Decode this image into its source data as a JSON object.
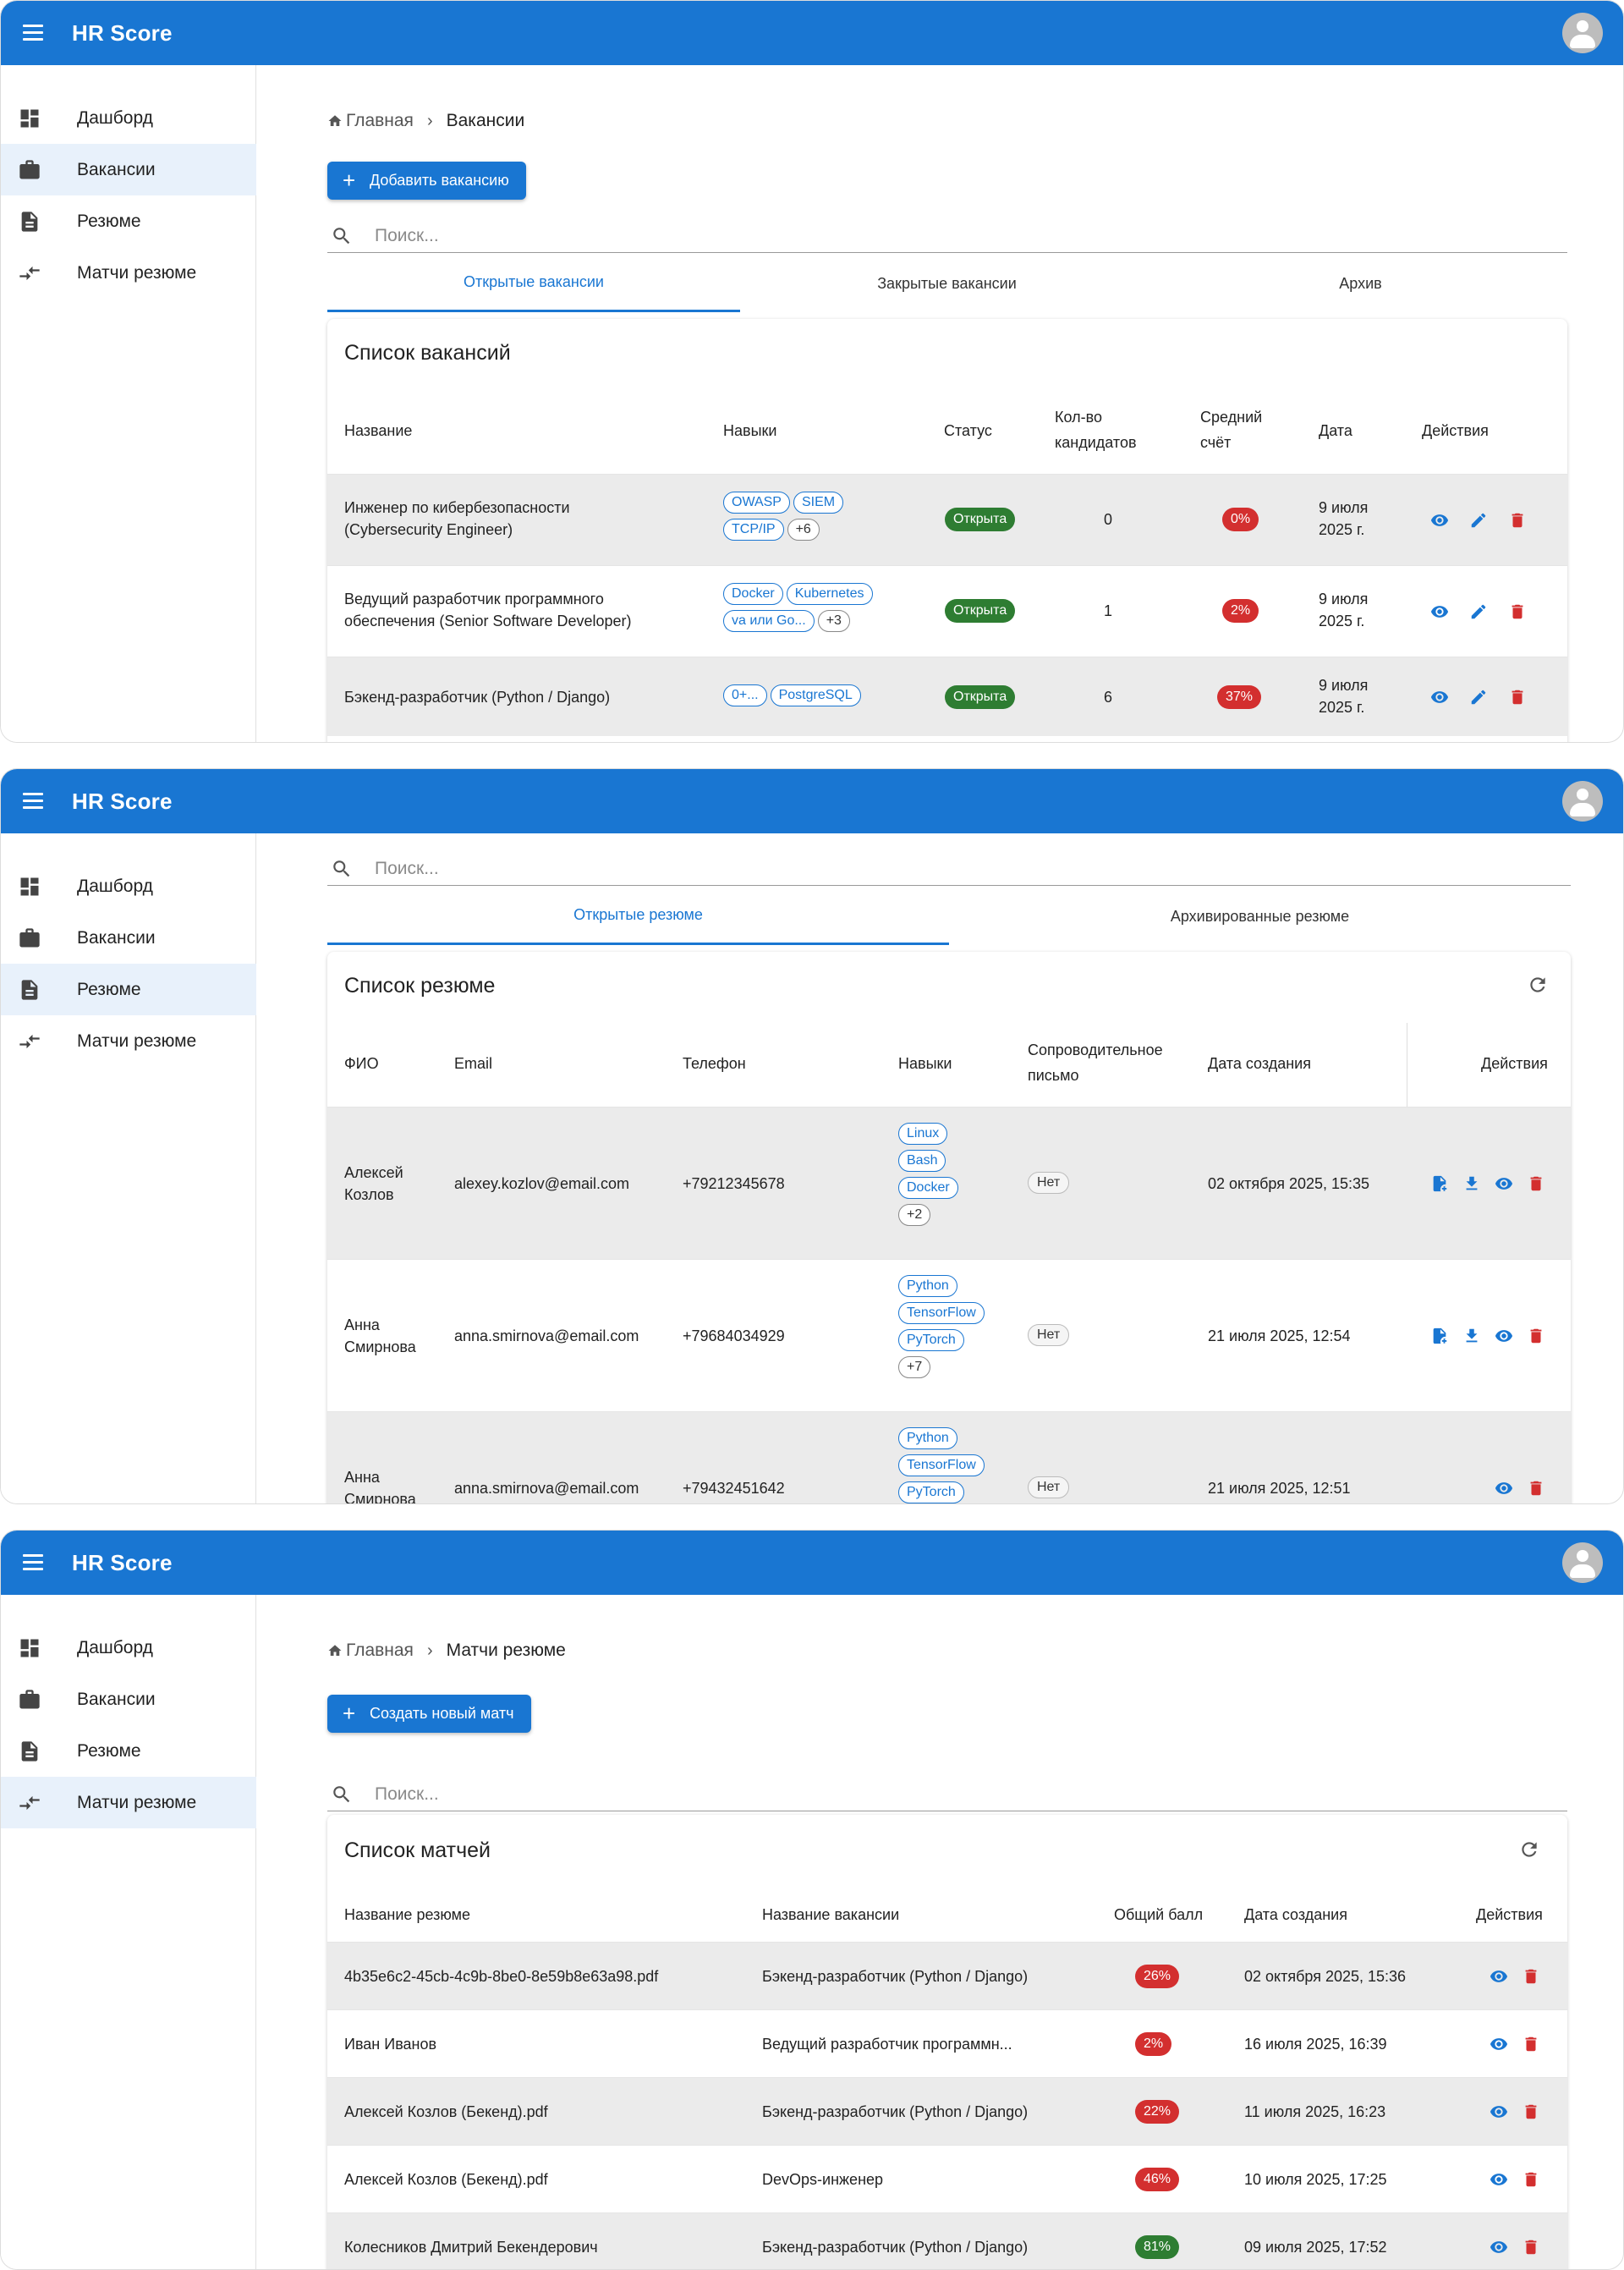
{
  "app": {
    "title": "HR Score"
  },
  "nav": {
    "dashboard": "Дашборд",
    "vacancies": "Вакансии",
    "resumes": "Резюме",
    "matches": "Матчи резюме"
  },
  "vacancies_page": {
    "breadcrumb": {
      "home": "Главная",
      "current": "Вакансии"
    },
    "add_button": "Добавить вакансию",
    "search_placeholder": "Поиск...",
    "tabs": [
      "Открытые вакансии",
      "Закрытые вакансии",
      "Архив"
    ],
    "card_title": "Список вакансий",
    "headers": {
      "name": "Название",
      "skills": "Навыки",
      "status": "Статус",
      "count_1": "Кол-во",
      "count_2": "кандидатов",
      "score_1": "Средний",
      "score_2": "счёт",
      "date": "Дата",
      "actions": "Действия"
    },
    "rows": [
      {
        "name_1": "Инженер по кибербезопасности",
        "name_2": "(Cybersecurity Engineer)",
        "skills": [
          "OWASP",
          "SIEM",
          "TCP/IP"
        ],
        "more": "+6",
        "status": "Открыта",
        "count": "0",
        "score": "0%",
        "date_1": "9 июля",
        "date_2": "2025 г."
      },
      {
        "name_1": "Ведущий разработчик программного",
        "name_2": "обеспечения (Senior Software Developer)",
        "skills": [
          "Docker",
          "Kubernetes",
          "va или Go..."
        ],
        "more": "+3",
        "status": "Открыта",
        "count": "1",
        "score": "2%",
        "date_1": "9 июля",
        "date_2": "2025 г."
      },
      {
        "name_1": "Бэкенд-разработчик (Python / Django)",
        "name_2": "",
        "skills": [
          "0+...",
          "PostgreSQL"
        ],
        "more": "",
        "status": "Открыта",
        "count": "6",
        "score": "37%",
        "date_1": "9 июля",
        "date_2": "2025 г."
      }
    ]
  },
  "resumes_page": {
    "search_placeholder": "Поиск...",
    "tabs": [
      "Открытые резюме",
      "Архивированные резюме"
    ],
    "card_title": "Список резюме",
    "headers": {
      "fio": "ФИО",
      "email": "Email",
      "phone": "Телефон",
      "skills": "Навыки",
      "cover_1": "Сопроводительное",
      "cover_2": "письмо",
      "created": "Дата создания",
      "actions": "Действия"
    },
    "rows": [
      {
        "name_1": "Алексей",
        "name_2": "Козлов",
        "email": "alexey.kozlov@email.com",
        "phone": "+79212345678",
        "skills": [
          "Linux",
          "Bash",
          "Docker"
        ],
        "more": "+2",
        "cover": "Нет",
        "created": "02 октября 2025, 15:35"
      },
      {
        "name_1": "Анна",
        "name_2": "Смирнова",
        "email": "anna.smirnova@email.com",
        "phone": "+79684034929",
        "skills": [
          "Python",
          "TensorFlow",
          "PyTorch"
        ],
        "more": "+7",
        "cover": "Нет",
        "created": "21 июля 2025, 12:54"
      },
      {
        "name_1": "Анна",
        "name_2": "Смирнова",
        "email": "anna.smirnova@email.com",
        "phone": "+79432451642",
        "skills": [
          "Python",
          "TensorFlow",
          "PyTorch"
        ],
        "more": "",
        "cover": "Нет",
        "created": "21 июля 2025, 12:51"
      }
    ]
  },
  "matches_page": {
    "breadcrumb": {
      "home": "Главная",
      "current": "Матчи резюме"
    },
    "create_button": "Создать новый матч",
    "search_placeholder": "Поиск...",
    "card_title": "Список матчей",
    "headers": {
      "resume": "Название резюме",
      "vacancy": "Название вакансии",
      "score": "Общий балл",
      "created": "Дата создания",
      "actions": "Действия"
    },
    "rows": [
      {
        "resume": "4b35e6c2-45cb-4c9b-8be0-8e59b8e63a98.pdf",
        "vacancy": "Бэкенд-разработчик (Python / Django)",
        "score": "26%",
        "score_color": "#d32f2f",
        "created": "02 октября 2025, 15:36"
      },
      {
        "resume": "Иван Иванов",
        "vacancy": "Ведущий разработчик программн...",
        "score": "2%",
        "score_color": "#d32f2f",
        "created": "16 июля 2025, 16:39"
      },
      {
        "resume": "Алексей Козлов (Бекенд).pdf",
        "vacancy": "Бэкенд-разработчик (Python / Django)",
        "score": "22%",
        "score_color": "#d32f2f",
        "created": "11 июля 2025, 16:23"
      },
      {
        "resume": "Алексей Козлов (Бекенд).pdf",
        "vacancy": "DevOps-инженер",
        "score": "46%",
        "score_color": "#d32f2f",
        "created": "10 июля 2025, 17:25"
      },
      {
        "resume": "Колесников Дмитрий Бекендерович",
        "vacancy": "Бэкенд-разработчик (Python / Django)",
        "score": "81%",
        "score_color": "#2e7d32",
        "created": "09 июля 2025, 17:52"
      }
    ]
  },
  "colors": {
    "primary": "#1976d2",
    "status_open": "#2e7d32",
    "score_low": "#d32f2f",
    "delete": "#d32f2f"
  }
}
